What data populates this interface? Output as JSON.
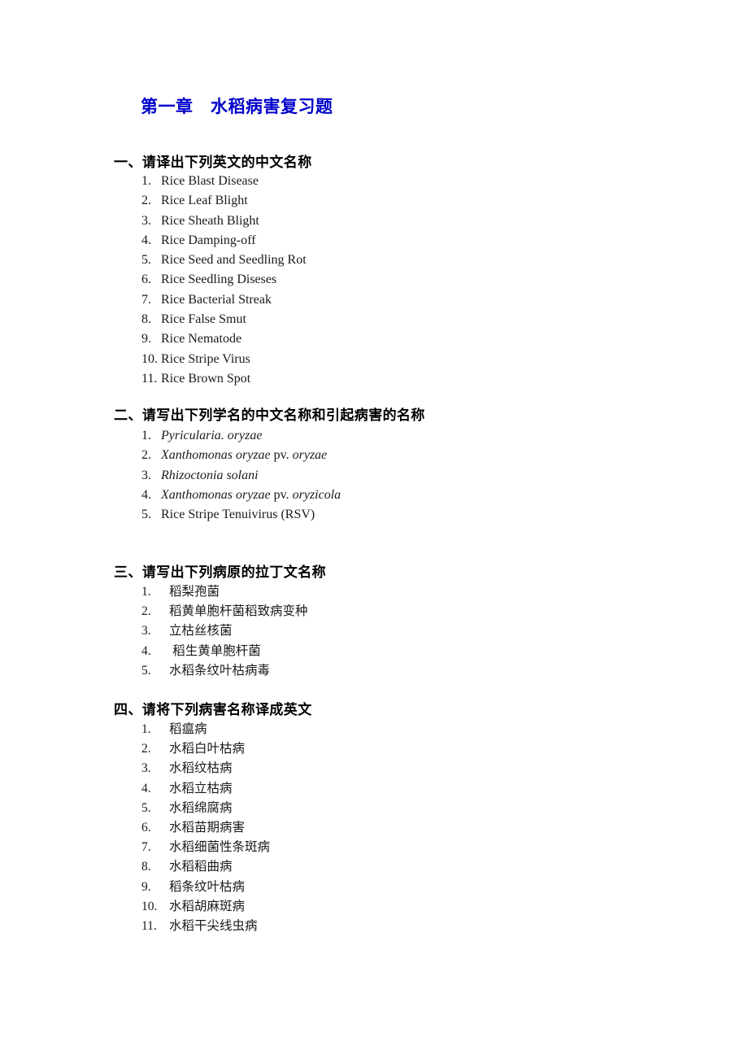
{
  "document": {
    "title": "第一章　水稻病害复习题",
    "title_color": "#0000CC"
  },
  "sections": [
    {
      "heading": "一、请译出下列英文的中文名称",
      "items": [
        {
          "num": "1.",
          "text": "Rice Blast Disease"
        },
        {
          "num": "2.",
          "text": "Rice Leaf Blight"
        },
        {
          "num": "3.",
          "text": "Rice Sheath Blight"
        },
        {
          "num": "4.",
          "text": "Rice Damping-off"
        },
        {
          "num": "5.",
          "text": "Rice Seed and Seedling Rot"
        },
        {
          "num": "6.",
          "text": "Rice Seedling Diseses"
        },
        {
          "num": "7.",
          "text": "Rice Bacterial Streak"
        },
        {
          "num": "8.",
          "text": "Rice False Smut"
        },
        {
          "num": "9.",
          "text": "Rice Nematode"
        },
        {
          "num": "10.",
          "text": "Rice Stripe Virus"
        },
        {
          "num": "11.",
          "text": "Rice Brown Spot"
        }
      ]
    },
    {
      "heading": "二、请写出下列学名的中文名称和引起病害的名称",
      "items": [
        {
          "num": "1.",
          "italic": "Pyricularia. oryzae",
          "roman": "",
          "italic2": ""
        },
        {
          "num": "2.",
          "italic": "Xanthomonas oryzae",
          "roman": " pv.",
          "italic2": " oryzae"
        },
        {
          "num": "3.",
          "italic": "Rhizoctonia solani",
          "roman": "",
          "italic2": ""
        },
        {
          "num": "4.",
          "italic": "Xanthomonas oryzae",
          "roman": " pv.",
          "italic2": " oryzicola"
        },
        {
          "num": "5.",
          "italic": "",
          "roman": "Rice Stripe Tenuivirus (RSV)",
          "italic2": ""
        }
      ]
    },
    {
      "heading": "三、请写出下列病原的拉丁文名称",
      "items": [
        {
          "num": "1.",
          "text": "稻梨孢菌"
        },
        {
          "num": "2.",
          "text": "稻黄单胞杆菌稻致病变种"
        },
        {
          "num": "3.",
          "text": "立枯丝核菌"
        },
        {
          "num": "4.",
          "text": " 稻生黄单胞杆菌"
        },
        {
          "num": "5.",
          "text": "水稻条纹叶枯病毒"
        }
      ]
    },
    {
      "heading": "四、请将下列病害名称译成英文",
      "items": [
        {
          "num": "1.",
          "text": "稻瘟病"
        },
        {
          "num": "2.",
          "text": "水稻白叶枯病"
        },
        {
          "num": "3.",
          "text": "水稻纹枯病"
        },
        {
          "num": "4.",
          "text": "水稻立枯病"
        },
        {
          "num": "5.",
          "text": "水稻绵腐病"
        },
        {
          "num": "6.",
          "text": "水稻苗期病害"
        },
        {
          "num": "7.",
          "text": "水稻细菌性条斑病"
        },
        {
          "num": "8.",
          "text": "水稻稻曲病"
        },
        {
          "num": "9.",
          "text": "稻条纹叶枯病"
        },
        {
          "num": "10.",
          "text": "水稻胡麻斑病"
        },
        {
          "num": "11.",
          "text": "水稻干尖线虫病"
        }
      ]
    }
  ]
}
